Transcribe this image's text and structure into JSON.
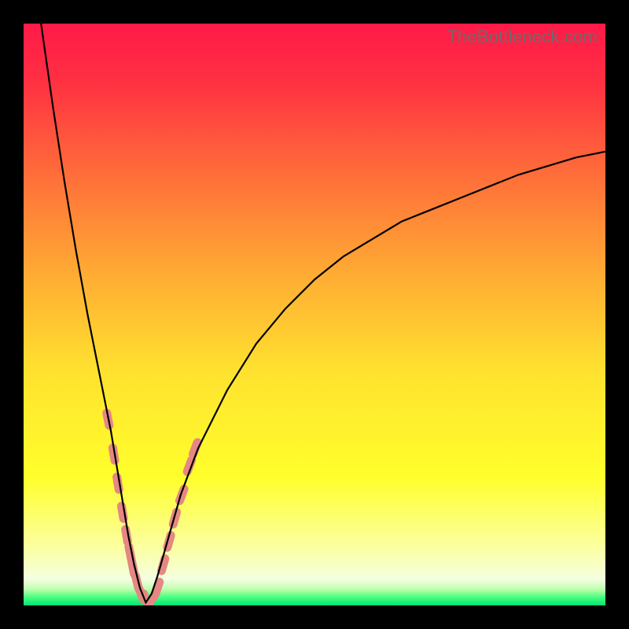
{
  "watermark": "TheBottleneck.com",
  "colors": {
    "frame": "#000000",
    "curve_stroke": "#000000",
    "marker_fill": "#e58783",
    "gradient_stops": [
      {
        "offset": 0.0,
        "color": "#ff1a48"
      },
      {
        "offset": 0.1,
        "color": "#ff3042"
      },
      {
        "offset": 0.25,
        "color": "#ff6a3a"
      },
      {
        "offset": 0.45,
        "color": "#ffb233"
      },
      {
        "offset": 0.6,
        "color": "#ffe22f"
      },
      {
        "offset": 0.78,
        "color": "#ffff2b"
      },
      {
        "offset": 0.9,
        "color": "#fbffa0"
      },
      {
        "offset": 0.955,
        "color": "#f4ffe0"
      },
      {
        "offset": 0.972,
        "color": "#c0ffb0"
      },
      {
        "offset": 0.985,
        "color": "#50ff80"
      },
      {
        "offset": 1.0,
        "color": "#00e676"
      }
    ]
  },
  "chart_data": {
    "type": "line",
    "title": "",
    "xlabel": "",
    "ylabel": "",
    "xlim": [
      0,
      100
    ],
    "ylim": [
      0,
      100
    ],
    "note": "V-shaped bottleneck curve. Minimum (~0) near x≈21. Left branch rises toward 100 at x≈3; right branch rises and levels off near ~78 at x=100. Values below are visually estimated from the plot.",
    "series": [
      {
        "name": "bottleneck_curve",
        "x": [
          3,
          5,
          7,
          9,
          11,
          13,
          15,
          17,
          18,
          19,
          20,
          21,
          22,
          23,
          25,
          27,
          30,
          35,
          40,
          45,
          50,
          55,
          60,
          65,
          70,
          75,
          80,
          85,
          90,
          95,
          100
        ],
        "y": [
          100,
          86,
          73,
          61,
          50,
          40,
          30,
          18,
          12,
          7,
          3,
          0.5,
          2,
          5,
          12,
          19,
          27,
          37,
          45,
          51,
          56,
          60,
          63,
          66,
          68,
          70,
          72,
          74,
          75.5,
          77,
          78
        ]
      }
    ],
    "markers": {
      "note": "Salmon-colored sample points clustered near the curve's minimum.",
      "points": [
        {
          "x": 14.5,
          "y": 32
        },
        {
          "x": 15.5,
          "y": 26
        },
        {
          "x": 16.2,
          "y": 21
        },
        {
          "x": 17.0,
          "y": 16
        },
        {
          "x": 17.7,
          "y": 12
        },
        {
          "x": 18.3,
          "y": 9
        },
        {
          "x": 18.8,
          "y": 6.5
        },
        {
          "x": 19.5,
          "y": 4
        },
        {
          "x": 20.2,
          "y": 2
        },
        {
          "x": 21.0,
          "y": 1
        },
        {
          "x": 22.0,
          "y": 1
        },
        {
          "x": 23.0,
          "y": 3
        },
        {
          "x": 24.0,
          "y": 7
        },
        {
          "x": 25.0,
          "y": 11
        },
        {
          "x": 26.0,
          "y": 15
        },
        {
          "x": 27.2,
          "y": 19
        },
        {
          "x": 28.5,
          "y": 24
        },
        {
          "x": 29.5,
          "y": 27
        }
      ]
    }
  }
}
